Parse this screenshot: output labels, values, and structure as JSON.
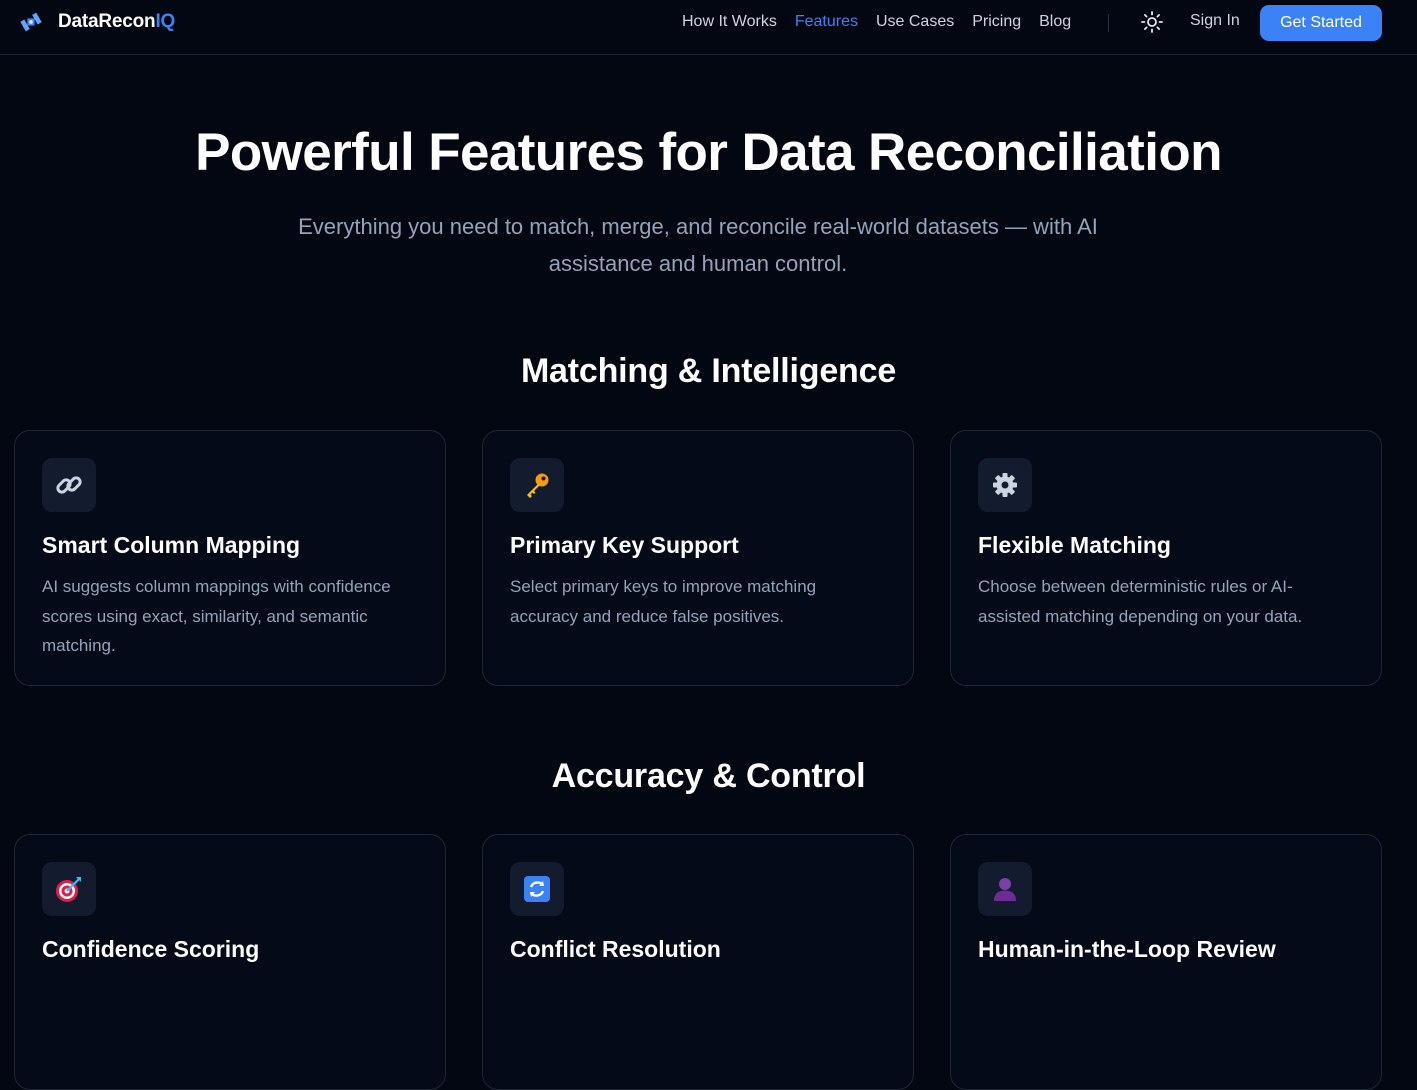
{
  "brand": {
    "name_main": "DataRecon",
    "name_accent": "IQ",
    "icon": "satellite-logo-icon"
  },
  "nav": {
    "links": [
      "How It Works",
      "Features",
      "Use Cases",
      "Pricing",
      "Blog"
    ],
    "active": "Features",
    "theme_icon": "sun-icon",
    "sign_in": "Sign In",
    "cta": "Get Started"
  },
  "hero": {
    "title": "Powerful Features for Data Reconciliation",
    "subtitle": "Everything you need to match, merge, and reconcile real-world datasets — with AI assistance and human control."
  },
  "sections": [
    {
      "title": "Matching & Intelligence",
      "cards": [
        {
          "icon": "link-icon",
          "title": "Smart Column Mapping",
          "description": "AI suggests column mappings with confidence scores using exact, similarity, and semantic matching."
        },
        {
          "icon": "key-icon",
          "title": "Primary Key Support",
          "description": "Select primary keys to improve matching accuracy and reduce false positives."
        },
        {
          "icon": "gear-icon",
          "title": "Flexible Matching",
          "description": "Choose between deterministic rules or AI-assisted matching depending on your data."
        }
      ]
    },
    {
      "title": "Accuracy & Control",
      "cards": [
        {
          "icon": "target-icon",
          "title": "Confidence Scoring",
          "description": ""
        },
        {
          "icon": "refresh-icon",
          "title": "Conflict Resolution",
          "description": ""
        },
        {
          "icon": "person-icon",
          "title": "Human-in-the-Loop Review",
          "description": ""
        }
      ]
    }
  ],
  "colors": {
    "background": "#030712",
    "accent": "#3b82f6",
    "card_border": "#1f2633",
    "muted_text": "#94a3b8"
  }
}
